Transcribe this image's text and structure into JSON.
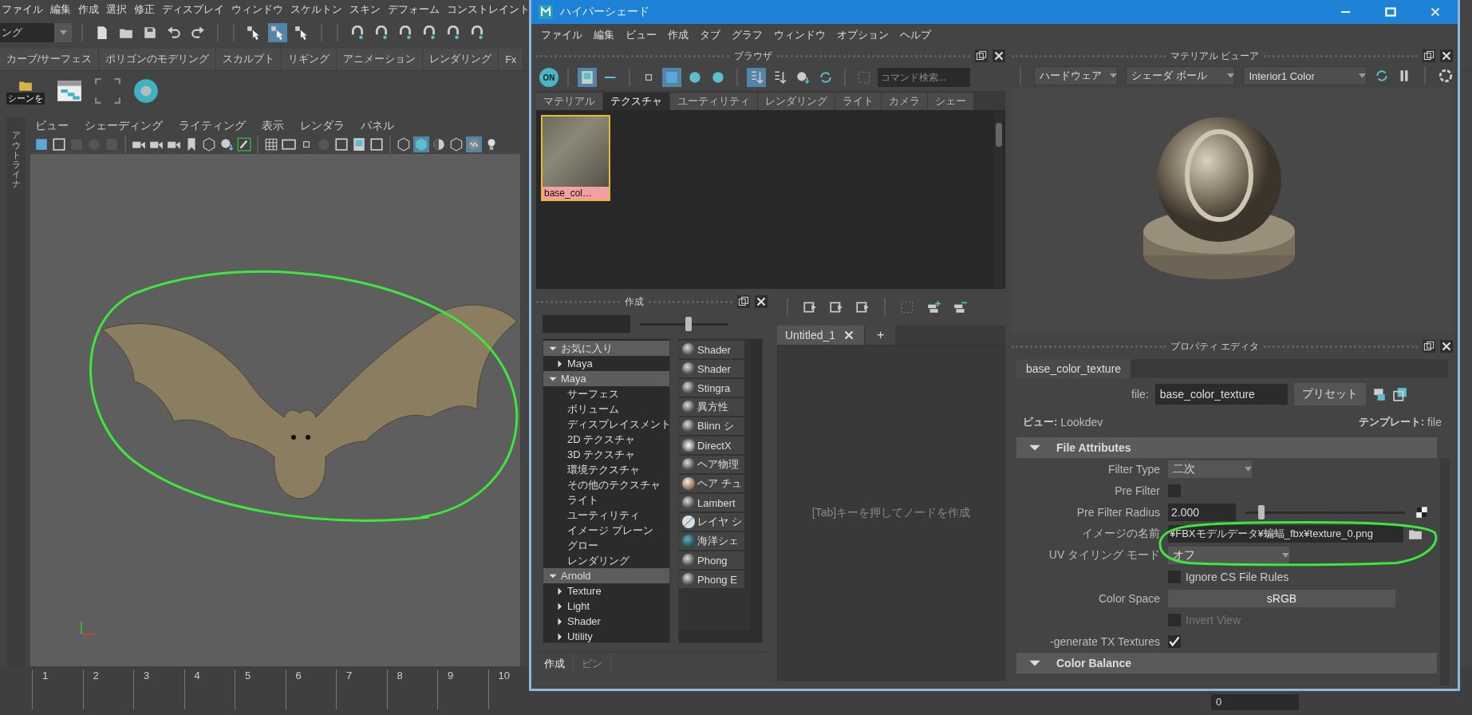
{
  "maya": {
    "menu": [
      "ファイル",
      "編集",
      "作成",
      "選択",
      "修正",
      "ディスプレイ",
      "ウィンドウ",
      "スケルトン",
      "スキン",
      "デフォーム",
      "コンストレイント"
    ],
    "mode_dropdown": "ング",
    "toolbar": [
      {
        "on": false
      },
      {
        "on": false
      },
      {
        "on": false
      },
      {
        "on": false
      },
      {
        "on": false
      },
      {
        "on": false
      },
      {
        "on": true
      },
      {
        "on": false
      },
      {
        "on": false
      },
      {
        "on": false
      },
      {
        "on": false
      },
      {
        "on": false
      },
      {
        "on": false
      },
      {
        "on": false
      }
    ],
    "shelf_tabs": [
      "カーブ/サーフェス",
      "ポリゴンのモデリング",
      "スカルプト",
      "リギング",
      "アニメーション",
      "レンダリング",
      "Fx"
    ],
    "shelf_label": "シーンを",
    "outliner_tab": "アウトライナ",
    "viewport_menu": [
      "ビュー",
      "シェーディング",
      "ライティング",
      "表示",
      "レンダラ",
      "パネル"
    ],
    "viewport_toolbar": [
      {
        "on": false
      },
      {
        "on": false
      },
      {
        "on": false
      },
      {
        "on": false
      },
      {
        "on": false
      },
      {
        "on": false
      },
      {
        "on": false
      },
      {
        "on": false
      },
      {
        "on": false
      },
      {
        "on": false
      },
      {
        "on": false
      },
      {
        "on": false
      },
      {
        "on": false
      },
      {
        "on": false
      },
      {
        "on": false
      },
      {
        "on": false
      },
      {
        "on": false
      },
      {
        "on": false
      },
      {
        "on": false
      },
      {
        "on": false
      },
      {
        "on": true
      },
      {
        "on": false
      },
      {
        "on": false
      },
      {
        "on": true
      },
      {
        "on": false
      }
    ],
    "timeline": [
      "1",
      "2",
      "3",
      "4",
      "5",
      "6",
      "7",
      "8",
      "9",
      "10"
    ],
    "frame_field": "0"
  },
  "hypershade": {
    "title": "ハイパーシェード",
    "menu": [
      "ファイル",
      "編集",
      "ビュー",
      "作成",
      "タブ",
      "グラフ",
      "ウィンドウ",
      "オプション",
      "ヘルプ"
    ],
    "browser": {
      "title": "ブラウザ",
      "on_button": "ON",
      "toolbar": [
        {
          "on": true
        },
        {
          "on": false
        },
        {
          "on": false
        },
        {
          "on": true
        },
        {
          "on": false
        },
        {
          "on": false
        },
        {
          "on": true
        },
        {
          "on": false
        },
        {
          "on": false
        },
        {
          "on": false
        },
        {
          "on": false
        }
      ],
      "search_placeholder": "コマンド検索...",
      "tabs": [
        {
          "label": "マテリアル",
          "selected": false
        },
        {
          "label": "テクスチャ",
          "selected": true
        },
        {
          "label": "ユーティリティ",
          "selected": false
        },
        {
          "label": "レンダリング",
          "selected": false
        },
        {
          "label": "ライト",
          "selected": false
        },
        {
          "label": "カメラ",
          "selected": false
        },
        {
          "label": "シェー",
          "selected": false
        }
      ],
      "swatches": [
        {
          "label": "base_col…",
          "selected": true
        }
      ]
    },
    "create": {
      "title": "作成",
      "level": 0.55,
      "tree": [
        {
          "label": "お気に入り",
          "expanded": true,
          "children": [
            {
              "label": "Maya",
              "expanded": false
            }
          ]
        },
        {
          "label": "Maya",
          "expanded": true,
          "children": [
            {
              "label": "サーフェス"
            },
            {
              "label": "ボリューム"
            },
            {
              "label": "ディスプレイスメント"
            },
            {
              "label": "2D テクスチャ"
            },
            {
              "label": "3D テクスチャ"
            },
            {
              "label": "環境テクスチャ"
            },
            {
              "label": "その他のテクスチャ"
            },
            {
              "label": "ライト"
            },
            {
              "label": "ユーティリティ"
            },
            {
              "label": "イメージ プレーン"
            },
            {
              "label": "グロー"
            },
            {
              "label": "レンダリング"
            }
          ]
        },
        {
          "label": "Arnold",
          "expanded": true,
          "children": [
            {
              "label": "Texture",
              "expanded": false
            },
            {
              "label": "Light",
              "expanded": false
            },
            {
              "label": "Shader",
              "expanded": false
            },
            {
              "label": "Utility",
              "expanded": false
            }
          ]
        }
      ],
      "nodes": [
        {
          "label": "Shader",
          "kind": "sphere"
        },
        {
          "label": "Shader",
          "kind": "sphere"
        },
        {
          "label": "Stingra",
          "kind": "sphere"
        },
        {
          "label": "異方性",
          "kind": "sphere"
        },
        {
          "label": "Blinn シ",
          "kind": "sphere"
        },
        {
          "label": "DirectX",
          "kind": "image"
        },
        {
          "label": "ヘア物理",
          "kind": "sphere"
        },
        {
          "label": "ヘア チュ",
          "kind": "hair"
        },
        {
          "label": "Lambert",
          "kind": "sphere"
        },
        {
          "label": "レイヤ シ",
          "kind": "layer"
        },
        {
          "label": "海洋シェ",
          "kind": "ocean"
        },
        {
          "label": "Phong",
          "kind": "sphere"
        },
        {
          "label": "Phong E",
          "kind": "sphere"
        }
      ],
      "bottom_tabs": [
        {
          "label": "作成",
          "selected": true
        },
        {
          "label": "ピン",
          "selected": false
        }
      ]
    },
    "node_editor": {
      "tabs": [
        {
          "label": "Untitled_1",
          "selected": true
        }
      ],
      "add_tab": "+",
      "hint": "[Tab]キーを押してノードを作成"
    },
    "material_viewer": {
      "title": "マテリアル ビューア",
      "dropdowns": [
        "ハードウェア",
        "シェーダ ボール",
        "Interior1 Color"
      ]
    },
    "property_editor": {
      "title": "プロパティ エディタ",
      "tab": "base_color_texture",
      "file_label": "file:",
      "file_value": "base_color_texture",
      "preset": "プリセット",
      "view_label": "ビュー:",
      "view_value": "Lookdev",
      "template_label": "テンプレート:",
      "template_value": "file",
      "sections": [
        {
          "title": "File Attributes",
          "expanded": true,
          "rows": [
            {
              "kind": "dropdown",
              "label": "Filter Type",
              "value": "二次"
            },
            {
              "kind": "checkbox",
              "label": "Pre Filter",
              "checked": false
            },
            {
              "kind": "slider",
              "label": "Pre Filter Radius",
              "value": "2.000",
              "level": 0.1
            },
            {
              "kind": "file",
              "label": "イメージの名前",
              "value": "¥FBXモデルデータ¥蝙蝠_fbx¥texture_0.png"
            },
            {
              "kind": "dropdown",
              "label": "UV タイリング モード",
              "value": "オフ"
            },
            {
              "kind": "option",
              "text": "Ignore CS File Rules",
              "checked": false,
              "disabled": false
            },
            {
              "kind": "combo",
              "label": "Color Space",
              "value": "sRGB"
            },
            {
              "kind": "option",
              "text": "Invert View",
              "checked": false,
              "disabled": true
            },
            {
              "kind": "checkbox",
              "label": "-generate TX Textures",
              "checked": true
            }
          ]
        },
        {
          "title": "Color Balance",
          "expanded": true
        }
      ]
    }
  }
}
